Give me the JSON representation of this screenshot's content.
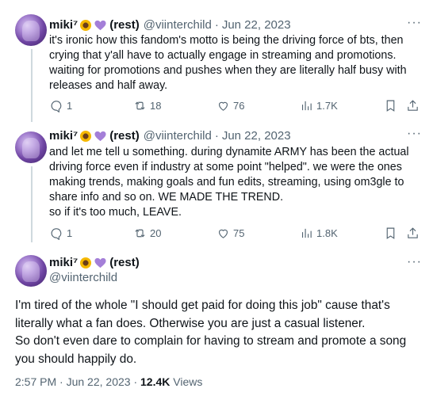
{
  "tweets": [
    {
      "name": "miki⁷",
      "label": "(rest)",
      "handle": "@viinterchild",
      "date": "Jun 22, 2023",
      "lines": [
        "it's ironic how this fandom's motto is being the driving force of bts, then",
        "crying that y'all have to actually engage in streaming and promotions.",
        "waiting for promotions and pushes when they are literally half busy with",
        "releases and half away."
      ],
      "stats": {
        "replies": "1",
        "retweets": "18",
        "likes": "76",
        "views": "1.7K"
      }
    },
    {
      "name": "miki⁷",
      "label": "(rest)",
      "handle": "@viinterchild",
      "date": "Jun 22, 2023",
      "lines": [
        "and let me tell u something. during dynamite ARMY has been the actual",
        "driving force even if industry at some point \"helped\". we were the ones",
        "making trends, making goals and fun edits, streaming, using om3gle to",
        "share info and so on. WE MADE THE TREND.",
        "so if it's too much, LEAVE."
      ],
      "stats": {
        "replies": "1",
        "retweets": "20",
        "likes": "75",
        "views": "1.8K"
      }
    }
  ],
  "main": {
    "name": "miki⁷",
    "label": "(rest)",
    "handle": "@viinterchild",
    "lines": [
      "I'm tired of the whole \"I should get paid for doing this job\" cause that's",
      "literally what a fan does. Otherwise you are just a casual listener.",
      "So don't even dare to complain for having to stream and promote a song",
      "you should happily do."
    ],
    "time": "2:57 PM",
    "date": "Jun 22, 2023",
    "views": "12.4K",
    "views_label": "Views"
  },
  "ui": {
    "more": "···",
    "dot": "·"
  },
  "colors": {
    "text": "#0f1419",
    "secondary": "#536471",
    "line": "#cfd9de",
    "heart": "#a47fd8"
  }
}
